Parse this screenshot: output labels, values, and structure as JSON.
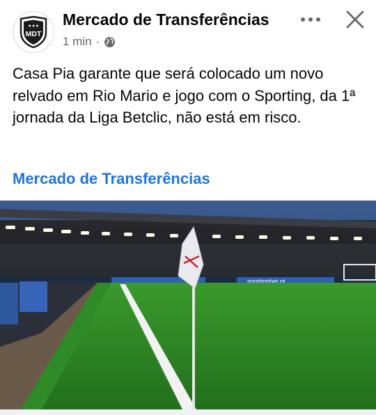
{
  "post": {
    "page_name": "Mercado de Transferências",
    "avatar_text": "MDT",
    "timestamp": "1 min",
    "separator": "·",
    "audience_icon": "globe-icon",
    "body_text": "Casa Pia garante que será colocado um novo relvado em Rio Mario e jogo com o Sporting, da 1ª jornada da Liga Betclic, não está em risco.",
    "link_title": "Mercado de Transferências",
    "image_ad_text": "sportingbet.pt"
  },
  "actions": {
    "more_icon": "more-horizontal-icon",
    "close_icon": "close-icon"
  },
  "colors": {
    "link": "#1b74e4",
    "meta": "#65676b",
    "text": "#050505",
    "pitch": "#2f8a28",
    "sky": "#2b4a7c"
  }
}
